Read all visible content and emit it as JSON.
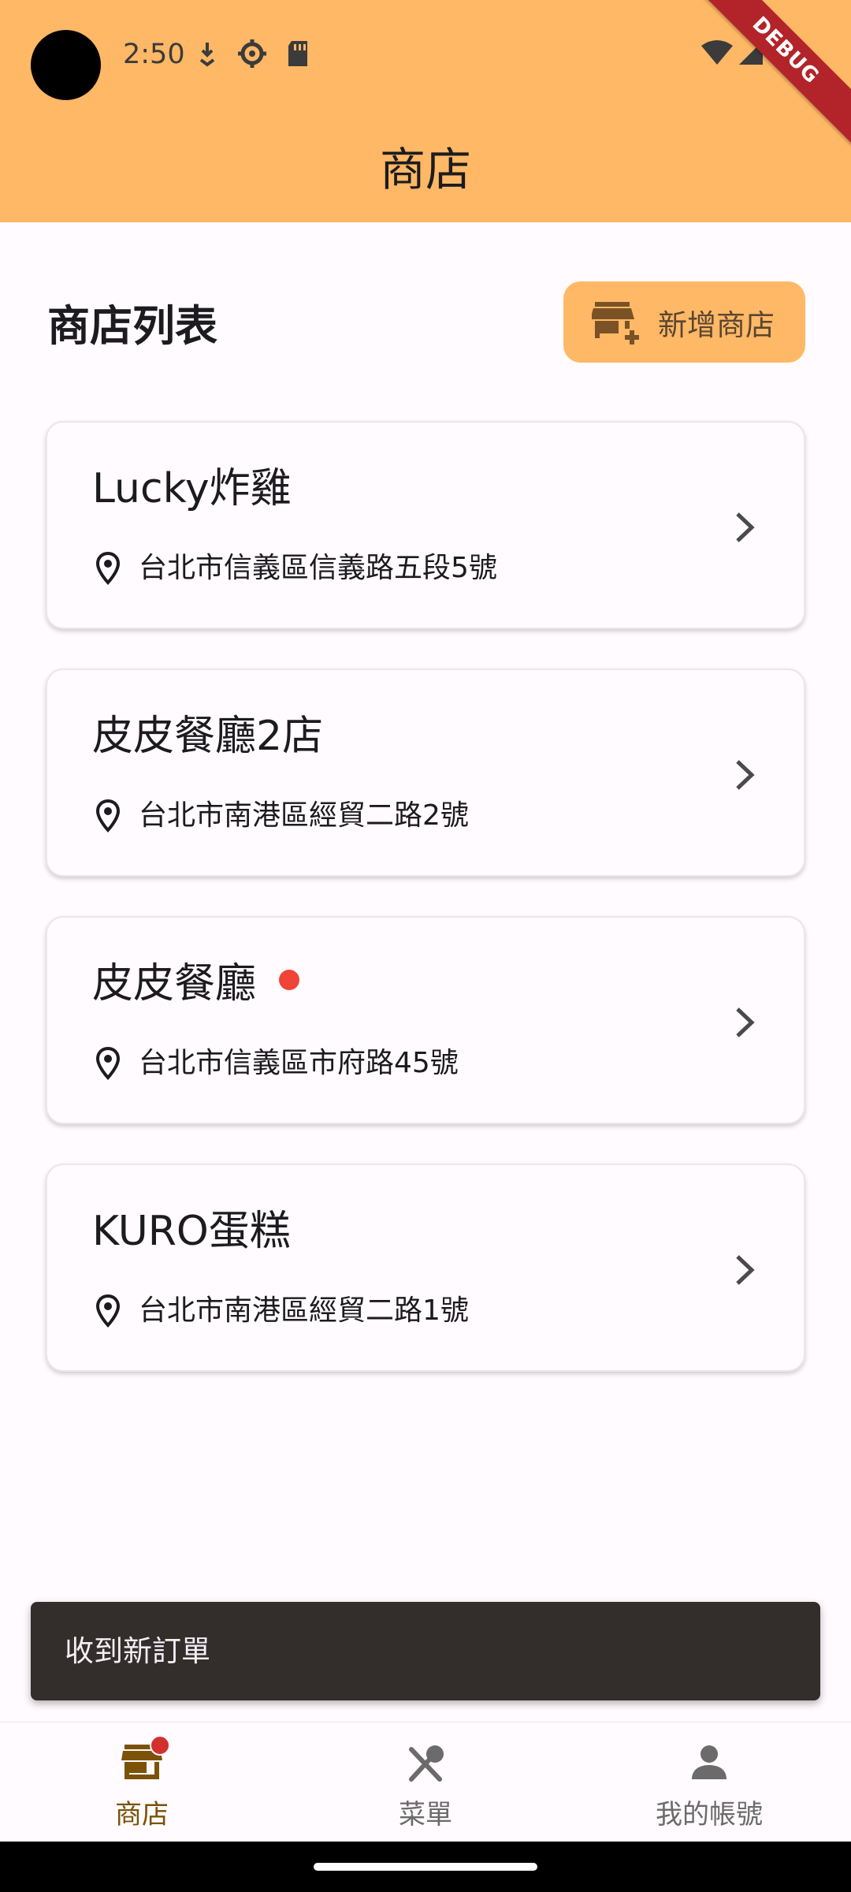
{
  "status_bar": {
    "time": "2:50"
  },
  "debug_banner": "DEBUG",
  "app_bar": {
    "title": "商店"
  },
  "section": {
    "title": "商店列表",
    "add_button_label": "新增商店"
  },
  "stores": [
    {
      "name": "Lucky炸雞",
      "address": "台北市信義區信義路五段5號",
      "has_new_order": false
    },
    {
      "name": "皮皮餐廳2店",
      "address": "台北市南港區經貿二路2號",
      "has_new_order": false
    },
    {
      "name": "皮皮餐廳",
      "address": "台北市信義區市府路45號",
      "has_new_order": true
    },
    {
      "name": "KURO蛋糕",
      "address": "台北市南港區經貿二路1號",
      "has_new_order": false
    }
  ],
  "snackbar": {
    "message": "收到新訂單"
  },
  "bottom_nav": {
    "items": [
      {
        "label": "商店",
        "icon": "store-icon",
        "active": true,
        "badge": true
      },
      {
        "label": "菜單",
        "icon": "utensils-icon",
        "active": false,
        "badge": false
      },
      {
        "label": "我的帳號",
        "icon": "person-icon",
        "active": false,
        "badge": false
      }
    ]
  },
  "colors": {
    "accent": "#FFB866",
    "badge": "#F04438",
    "snackbar": "#332E2B",
    "active_nav": "#7B5208"
  }
}
